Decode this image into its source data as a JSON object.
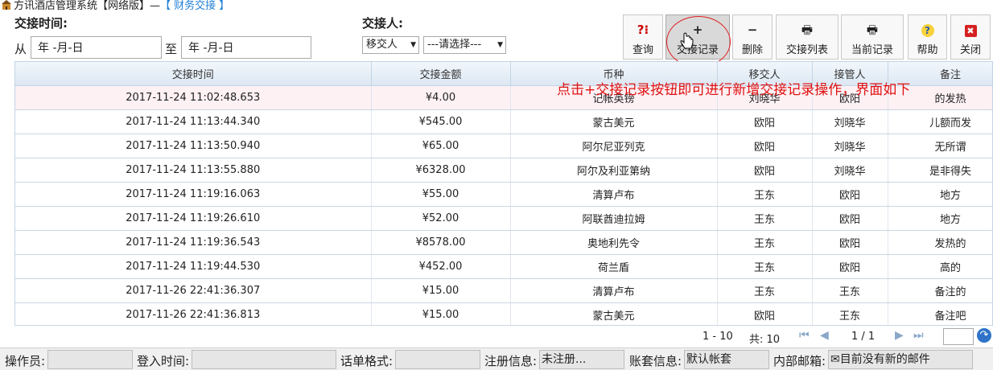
{
  "window": {
    "app_title": "方讯酒店管理系统【网络版】—",
    "module_title": "【 财务交接 】"
  },
  "filters": {
    "time_label": "交接时间:",
    "from_label": "从",
    "to_label": "至",
    "from_date": "年 -月-日",
    "to_date": "年 -月-日",
    "person_label": "交接人:",
    "person_field": "移交人",
    "person_select": "---请选择---"
  },
  "toolbar": [
    {
      "name": "query-button",
      "icon": "query-icon",
      "glyph": "?⁝",
      "label": "查询",
      "active": false
    },
    {
      "name": "add-record-button",
      "icon": "plus-icon",
      "glyph": "+",
      "label": "交接记录",
      "active": true
    },
    {
      "name": "delete-button",
      "icon": "minus-icon",
      "glyph": "−",
      "label": "删除",
      "active": false
    },
    {
      "name": "handover-list-button",
      "icon": "printer-icon",
      "glyph": "🖶",
      "label": "交接列表",
      "active": false
    },
    {
      "name": "current-record-button",
      "icon": "printer-icon",
      "glyph": "🖶",
      "label": "当前记录",
      "active": false
    },
    {
      "name": "help-button",
      "icon": "help-icon",
      "glyph": "?",
      "label": "帮助",
      "active": false
    },
    {
      "name": "close-button",
      "icon": "close-icon",
      "glyph": "✖",
      "label": "关闭",
      "active": false
    }
  ],
  "table": {
    "columns": [
      "交接时间",
      "交接金额",
      "币种",
      "移交人",
      "接管人",
      "备注"
    ],
    "rows": [
      [
        "2017-11-24 11:02:48.653",
        "¥4.00",
        "记帐英镑",
        "刘晓华",
        "欧阳",
        "的发热"
      ],
      [
        "2017-11-24 11:13:44.340",
        "¥545.00",
        "蒙古美元",
        "欧阳",
        "刘晓华",
        "儿额而发"
      ],
      [
        "2017-11-24 11:13:50.940",
        "¥65.00",
        "阿尔尼亚列克",
        "欧阳",
        "刘晓华",
        "无所谓"
      ],
      [
        "2017-11-24 11:13:55.880",
        "¥6328.00",
        "阿尔及利亚第纳",
        "欧阳",
        "刘晓华",
        "是非得失"
      ],
      [
        "2017-11-24 11:19:16.063",
        "¥55.00",
        "清算卢布",
        "王东",
        "欧阳",
        "地方"
      ],
      [
        "2017-11-24 11:19:26.610",
        "¥52.00",
        "阿联酋迪拉姆",
        "王东",
        "欧阳",
        "地方"
      ],
      [
        "2017-11-24 11:19:36.543",
        "¥8578.00",
        "奥地利先令",
        "王东",
        "欧阳",
        "发热的"
      ],
      [
        "2017-11-24 11:19:44.530",
        "¥452.00",
        "荷兰盾",
        "王东",
        "欧阳",
        "高的"
      ],
      [
        "2017-11-26 22:41:36.307",
        "¥15.00",
        "清算卢布",
        "王东",
        "王东",
        "备注的"
      ],
      [
        "2017-11-26 22:41:36.813",
        "¥15.00",
        "蒙古美元",
        "欧阳",
        "王东",
        "备注吧"
      ]
    ]
  },
  "pager": {
    "range": "1 - 10",
    "total": "共: 10",
    "page": "1 / 1",
    "page_input": ""
  },
  "annotation": "点击+交接记录按钮即可进行新增交接记录操作，界面如下",
  "status": {
    "operator_label": "操作员:",
    "operator_value": "",
    "login_label": "登入时间:",
    "login_value": "",
    "format_label": "话单格式:",
    "format_value": "",
    "register_label": "注册信息:",
    "register_value": "未注册...",
    "account_label": "账套信息:",
    "account_value": "默认帐套",
    "mail_label": "内部邮箱:",
    "mail_value": "目前没有新的邮件"
  },
  "colors": {
    "accent": "#1f7fd6",
    "annotation": "#e01010",
    "grid_header": "#dde8f3",
    "row_stripe": "#fdf1f4"
  }
}
